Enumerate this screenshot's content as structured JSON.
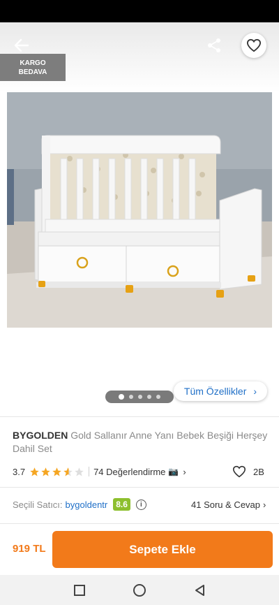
{
  "badge": {
    "line1": "KARGO",
    "line2": "BEDAVA"
  },
  "icons": {
    "back": "arrow-left-icon",
    "share": "share-icon",
    "favorite": "heart-outline-icon"
  },
  "gallery": {
    "dot_count": 5,
    "active_dot": 0
  },
  "features_button": {
    "label": "Tüm Özellikler",
    "chevron": "›"
  },
  "product": {
    "brand": "BYGOLDEN",
    "name": "Gold Sallanır Anne Yanı Bebek Beşiği Herşey Dahil Set"
  },
  "rating": {
    "value": "3.7",
    "stars": 3.7,
    "review_text": "74 Değerlendirme",
    "camera": "📷",
    "chevron": "›",
    "likes": "2B"
  },
  "seller": {
    "label": "Seçili Satıcı:",
    "name": "bygoldentr",
    "score": "8.6",
    "info": "i",
    "qa_text": "41 Soru & Cevap",
    "qa_chevron": "›"
  },
  "checkout": {
    "price": "919 TL",
    "button": "Sepete Ekle"
  },
  "colors": {
    "accent": "#f27a1a",
    "link": "#1f6fc7",
    "score": "#8dbf2e",
    "star": "#f5a623"
  }
}
